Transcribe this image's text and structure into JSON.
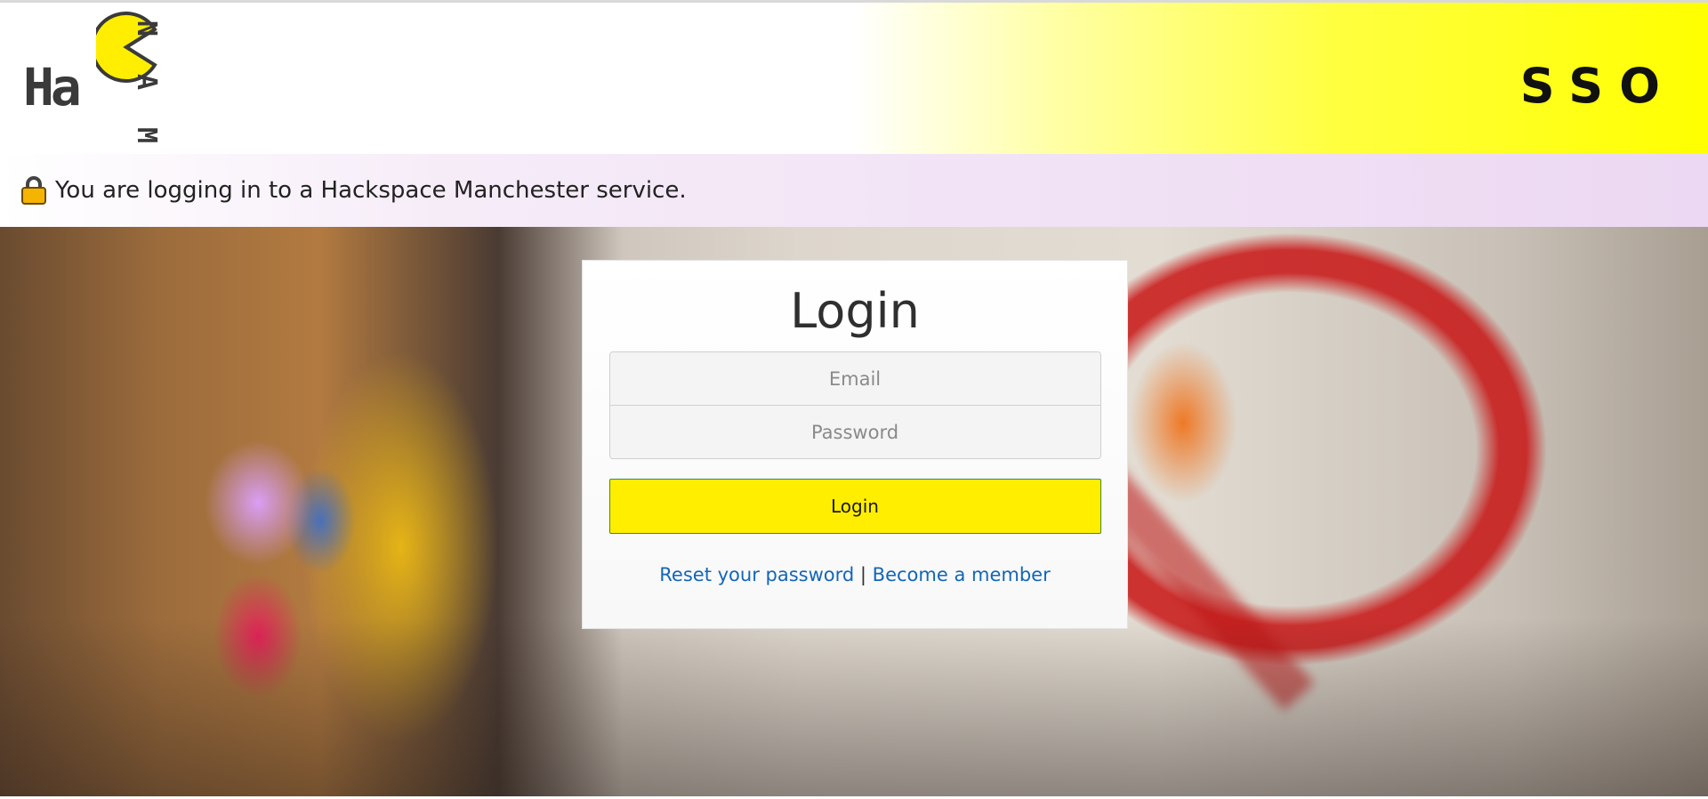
{
  "header": {
    "logo": {
      "text_left": "Ha",
      "text_vertical": [
        "N",
        "A",
        "M"
      ],
      "pacman_color": "#ffee00"
    },
    "title": "SSO"
  },
  "notice": {
    "icon": "lock-icon",
    "text": "You are logging in to a Hackspace Manchester service."
  },
  "login": {
    "title": "Login",
    "email_placeholder": "Email",
    "password_placeholder": "Password",
    "button_label": "Login",
    "reset_link": "Reset your password",
    "separator": "|",
    "member_link": "Become a member"
  },
  "colors": {
    "accent_yellow": "#ffee00",
    "link_blue": "#1266b8",
    "notice_lilac": "#ecd8f2"
  }
}
